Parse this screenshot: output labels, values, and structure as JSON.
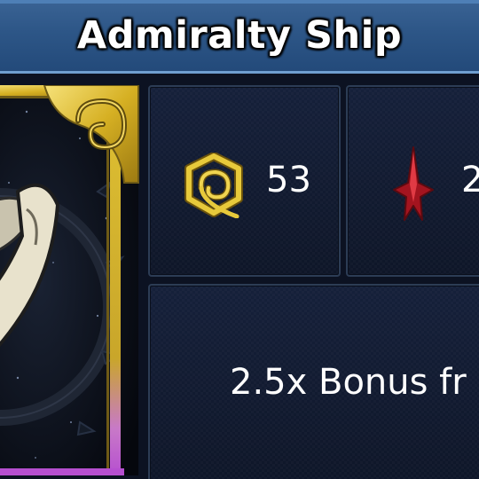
{
  "header": {
    "title": "Admiralty Ship"
  },
  "stats": [
    {
      "icon": "gold-spiral-resource-icon",
      "value": "53"
    },
    {
      "icon": "red-spike-resource-icon",
      "value": "2"
    }
  ],
  "bonus": {
    "text": "2.5x Bonus fr"
  },
  "colors": {
    "title_bar": "#2d5687",
    "panel_bg": "#0f1729",
    "frame_gold": "#d9b62a",
    "red_icon": "#c8202a"
  }
}
